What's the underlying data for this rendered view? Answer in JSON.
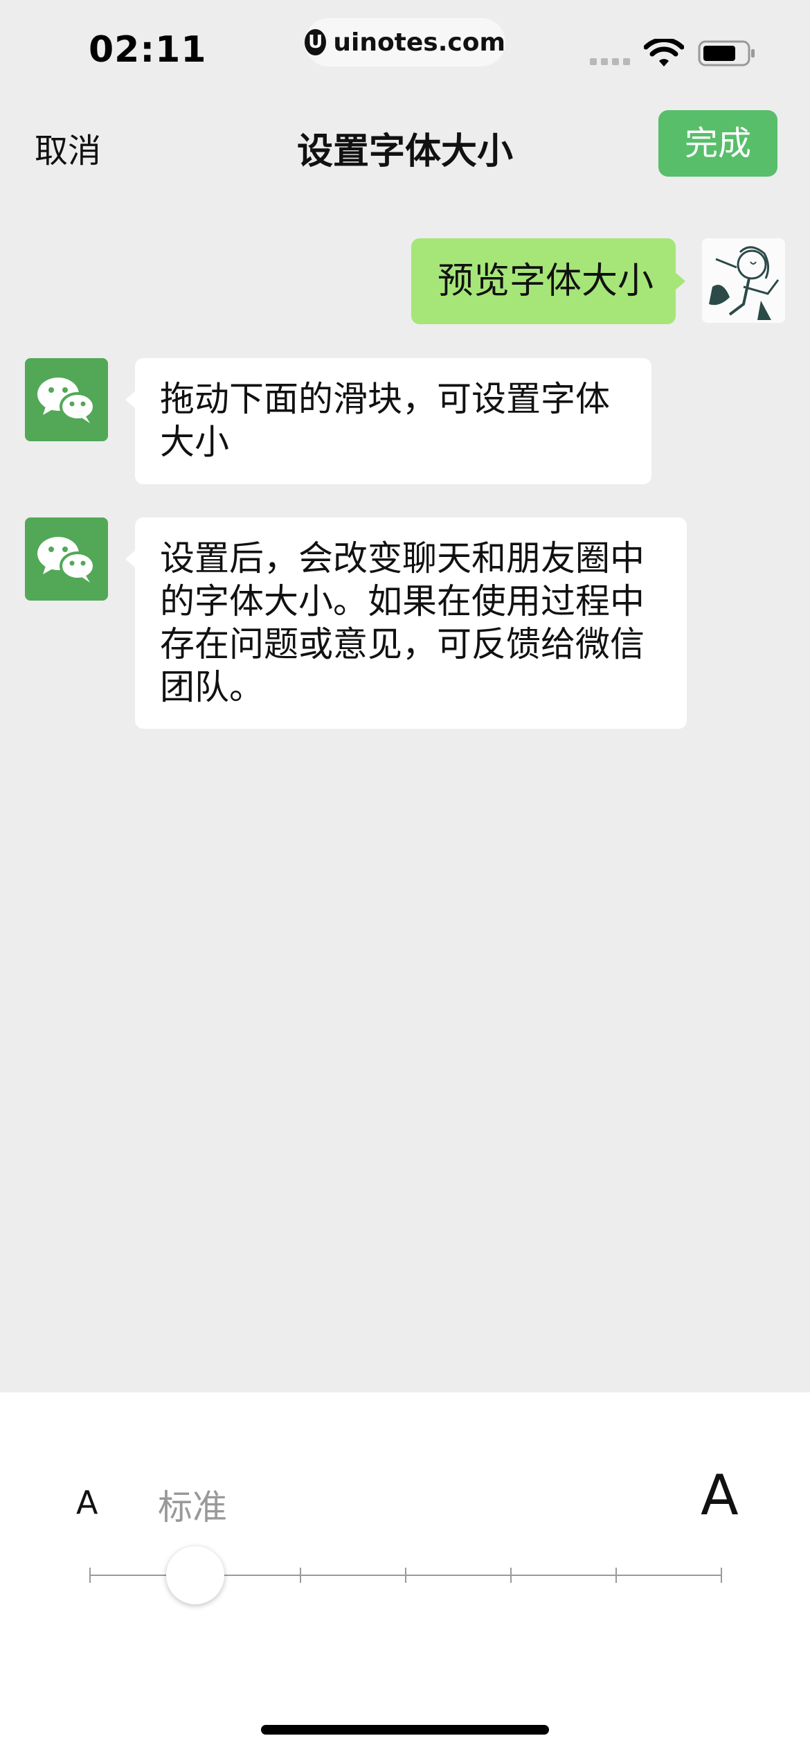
{
  "status_bar": {
    "time": "02:11",
    "url": "uinotes.com",
    "url_logo": "U",
    "wifi_icon": "wifi-icon",
    "battery_icon": "battery-icon"
  },
  "nav": {
    "cancel_label": "取消",
    "title": "设置字体大小",
    "done_label": "完成",
    "accent_color": "#58be6a"
  },
  "chat": {
    "outgoing": {
      "text": "预览字体大小",
      "bubble_color": "#a6e678"
    },
    "incoming": [
      {
        "lines": [
          "拖动下面的滑块，可设置字体",
          "大小"
        ]
      },
      {
        "lines": [
          "设置后，会改变聊天和朋友圈中",
          "的字体大小。如果在使用过程中",
          "存在问题或意见，可反馈给微信",
          "团队。"
        ]
      }
    ]
  },
  "font_size_control": {
    "small_label": "A",
    "current_level_label": "标准",
    "large_label": "A",
    "levels": 7,
    "selected_level_index": 1
  }
}
